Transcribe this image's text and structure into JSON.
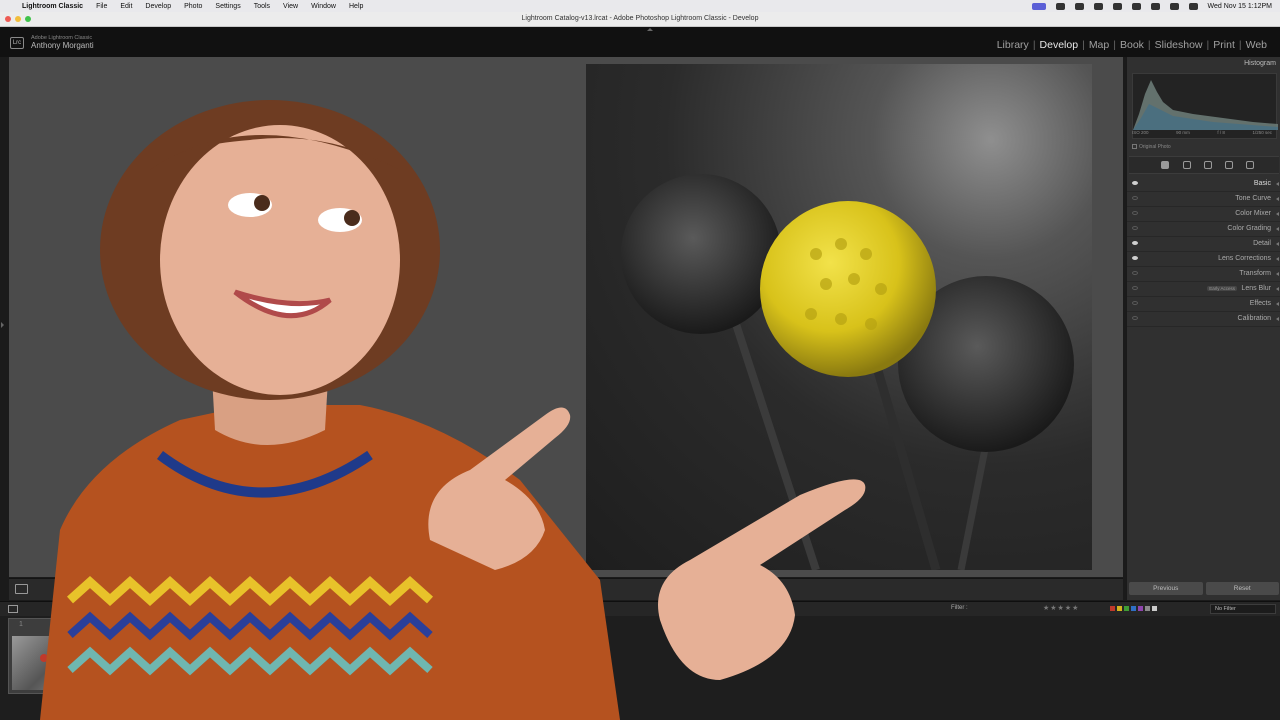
{
  "menubar": {
    "app_name": "Lightroom Classic",
    "items": [
      "File",
      "Edit",
      "Develop",
      "Photo",
      "Settings",
      "Tools",
      "View",
      "Window",
      "Help"
    ],
    "clock": "Wed Nov 15  1:12PM"
  },
  "window": {
    "title": "Lightroom Catalog-v13.lrcat - Adobe Photoshop Lightroom Classic - Develop"
  },
  "identity": {
    "badge": "Lrc",
    "app_line": "Adobe Lightroom Classic",
    "user": "Anthony Morganti"
  },
  "modules": {
    "items": [
      "Library",
      "Develop",
      "Map",
      "Book",
      "Slideshow",
      "Print",
      "Web"
    ],
    "active": "Develop"
  },
  "right_panel": {
    "histogram_title": "Histogram",
    "meta": [
      "ISO 200",
      "90 mm",
      "f / 8",
      "1/250 sec"
    ],
    "original_photo": "Original Photo",
    "panels": [
      {
        "label": "Basic",
        "eye_on": true,
        "active": true
      },
      {
        "label": "Tone Curve",
        "eye_on": false
      },
      {
        "label": "Color Mixer",
        "eye_on": false
      },
      {
        "label": "Color Grading",
        "eye_on": false
      },
      {
        "label": "Detail",
        "eye_on": true
      },
      {
        "label": "Lens Corrections",
        "eye_on": true
      },
      {
        "label": "Transform",
        "eye_on": false
      },
      {
        "label": "Lens Blur",
        "eye_on": false,
        "badge": "Early Access"
      },
      {
        "label": "Effects",
        "eye_on": false
      },
      {
        "label": "Calibration",
        "eye_on": false
      }
    ],
    "previous_button": "Previous",
    "reset_button": "Reset"
  },
  "filmstrip": {
    "filter_label": "Filter :",
    "filter_value": "No Filter",
    "stars": "★★★★★",
    "thumb_number": "1",
    "swatch_colors": [
      "#c0392b",
      "#d4b21f",
      "#3f9c35",
      "#2f6fc4",
      "#8e44ad",
      "#8a8a8a",
      "#cccccc"
    ]
  },
  "colors": {
    "menubar_accent": "#5b5fd6",
    "flower_yellow": "#d8c21a",
    "sweater_orange": "#b5521f"
  }
}
